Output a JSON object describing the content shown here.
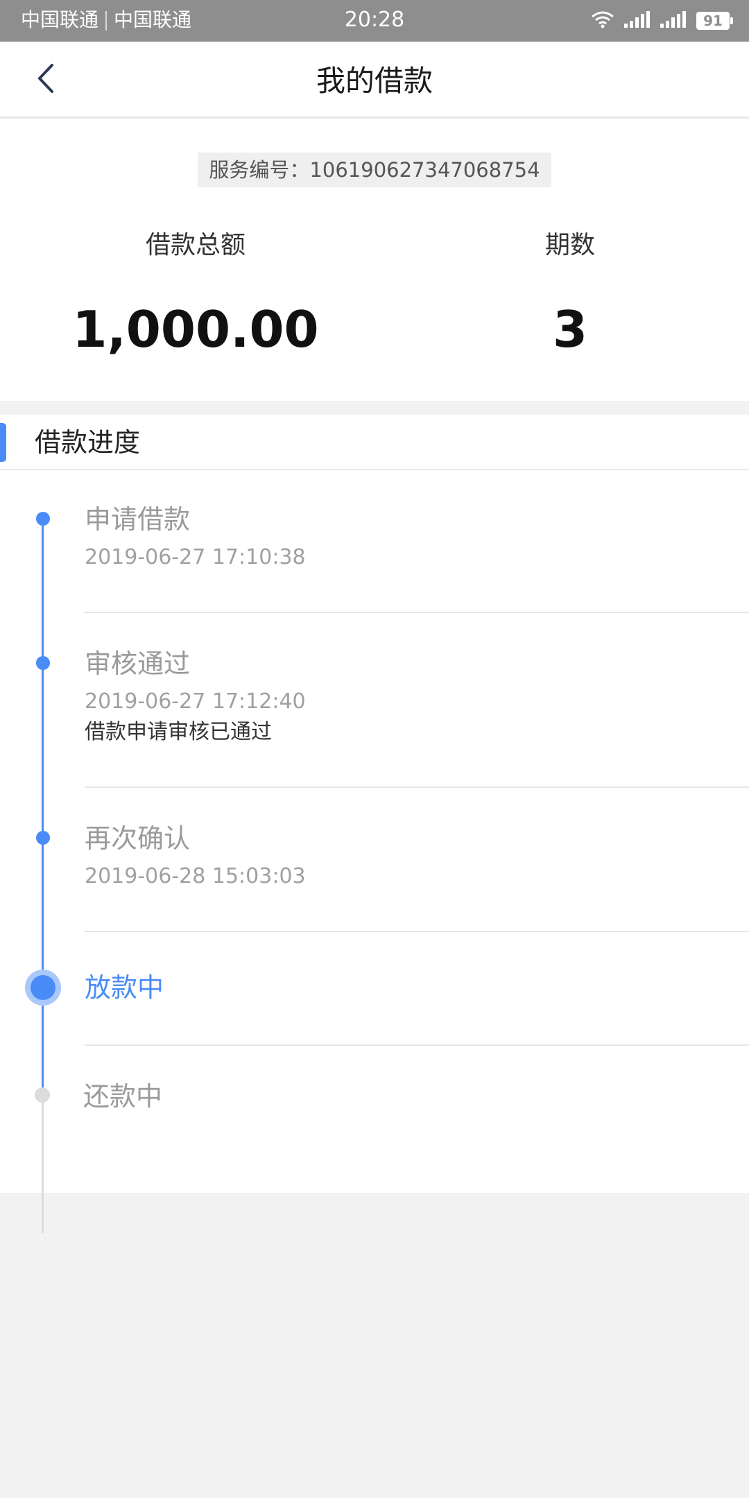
{
  "status_bar": {
    "carrier1": "中国联通",
    "carrier2": "中国联通",
    "time": "20:28",
    "battery": "91"
  },
  "nav": {
    "title": "我的借款",
    "back_icon": "chevron-left-icon"
  },
  "summary": {
    "service_label": "服务编号：",
    "service_number": "106190627347068754",
    "amount_label": "借款总额",
    "amount_value": "1,000.00",
    "periods_label": "期数",
    "periods_value": "3"
  },
  "progress": {
    "section_title": "借款进度",
    "steps": [
      {
        "title": "申请借款",
        "time": "2019-06-27 17:10:38",
        "desc": "",
        "state": "done"
      },
      {
        "title": "审核通过",
        "time": "2019-06-27 17:12:40",
        "desc": "借款申请审核已通过",
        "state": "done"
      },
      {
        "title": "再次确认",
        "time": "2019-06-28 15:03:03",
        "desc": "",
        "state": "done"
      },
      {
        "title": "放款中",
        "time": "",
        "desc": "",
        "state": "active"
      },
      {
        "title": "还款中",
        "time": "",
        "desc": "",
        "state": "pending"
      }
    ]
  },
  "colors": {
    "accent": "#4a8cf7",
    "status_bar": "#8e8e8e",
    "pending": "#dcdcdc"
  }
}
